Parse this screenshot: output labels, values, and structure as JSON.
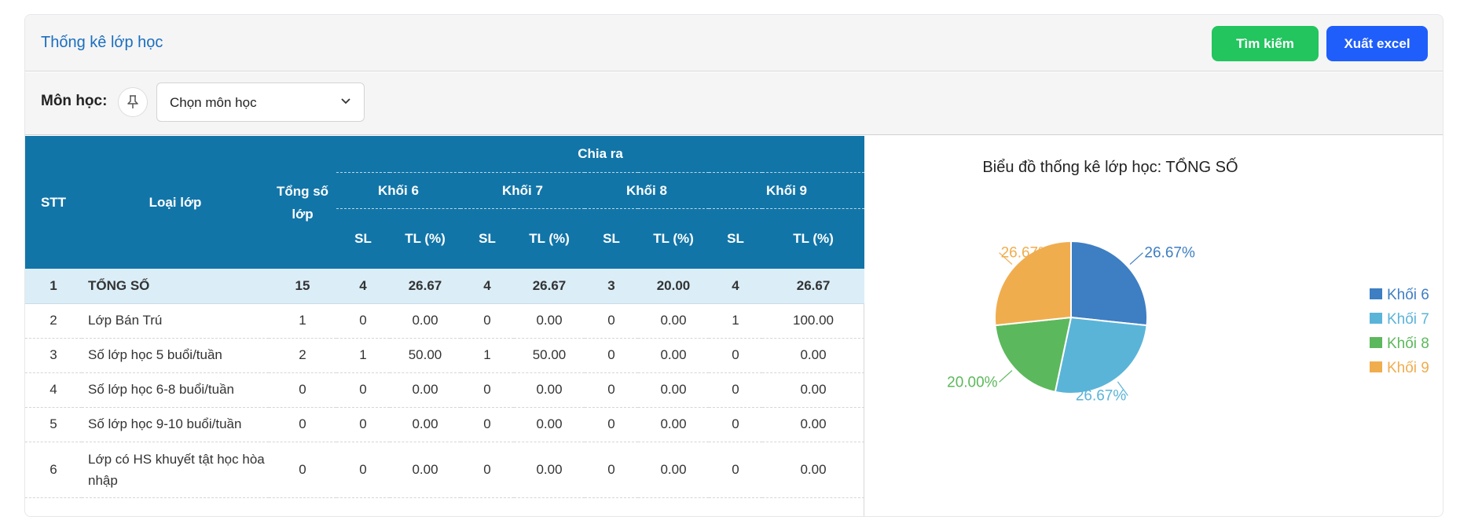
{
  "header": {
    "title": "Thống kê lớp học",
    "search_label": "Tìm kiếm",
    "export_label": "Xuất excel"
  },
  "filter": {
    "label": "Môn học:",
    "select_value": "Chọn môn học"
  },
  "table": {
    "headers": {
      "stt": "STT",
      "type": "Loại lớp",
      "total": "Tổng số lớp",
      "breakdown": "Chia ra",
      "grades": [
        "Khối 6",
        "Khối 7",
        "Khối 8",
        "Khối 9"
      ],
      "sl": "SL",
      "tl": "TL (%)"
    },
    "rows": [
      {
        "stt": "1",
        "type": "TỔNG SỐ",
        "total": "15",
        "vals": [
          "4",
          "26.67",
          "4",
          "26.67",
          "3",
          "20.00",
          "4",
          "26.67"
        ]
      },
      {
        "stt": "2",
        "type": "Lớp Bán Trú",
        "total": "1",
        "vals": [
          "0",
          "0.00",
          "0",
          "0.00",
          "0",
          "0.00",
          "1",
          "100.00"
        ]
      },
      {
        "stt": "3",
        "type": "Số lớp học 5 buổi/tuần",
        "total": "2",
        "vals": [
          "1",
          "50.00",
          "1",
          "50.00",
          "0",
          "0.00",
          "0",
          "0.00"
        ]
      },
      {
        "stt": "4",
        "type": "Số lớp học 6-8 buổi/tuần",
        "total": "0",
        "vals": [
          "0",
          "0.00",
          "0",
          "0.00",
          "0",
          "0.00",
          "0",
          "0.00"
        ]
      },
      {
        "stt": "5",
        "type": "Số lớp học 9-10 buổi/tuần",
        "total": "0",
        "vals": [
          "0",
          "0.00",
          "0",
          "0.00",
          "0",
          "0.00",
          "0",
          "0.00"
        ]
      },
      {
        "stt": "6",
        "type": "Lớp có HS khuyết tật học hòa nhập",
        "total": "0",
        "vals": [
          "0",
          "0.00",
          "0",
          "0.00",
          "0",
          "0.00",
          "0",
          "0.00"
        ]
      }
    ]
  },
  "chart_data": {
    "type": "pie",
    "title": "Biểu đồ thống kê lớp học: TỔNG SỐ",
    "categories": [
      "Khối 6",
      "Khối 7",
      "Khối 8",
      "Khối 9"
    ],
    "values": [
      26.67,
      26.67,
      20.0,
      26.67
    ],
    "labels": [
      "26.67%",
      "26.67%",
      "20.00%",
      "26.67%"
    ],
    "colors": [
      "#3e7ec3",
      "#5ab4d8",
      "#5cb85c",
      "#f0ad4e"
    ],
    "legend": "right"
  },
  "icons": {
    "pin": "pin-icon",
    "caret": "chevron-down-icon"
  }
}
